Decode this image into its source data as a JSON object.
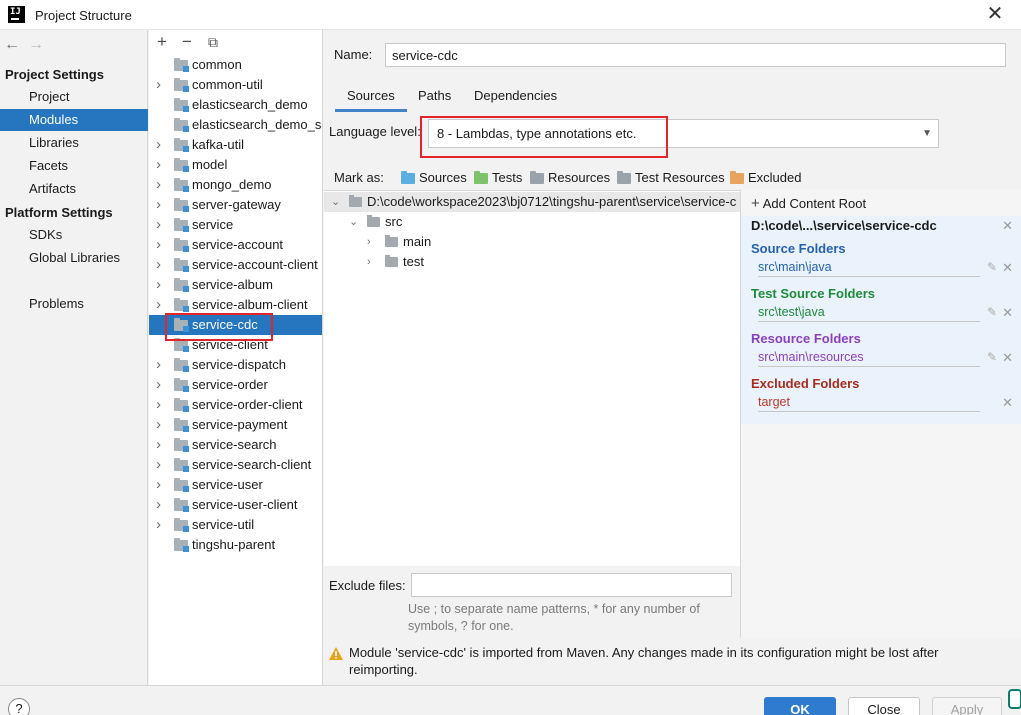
{
  "window": {
    "title": "Project Structure",
    "app_icon_text": "IJ"
  },
  "nav": {
    "back_glyph": "←",
    "forward_glyph": "→",
    "sections": [
      {
        "title": "Project Settings",
        "items": [
          "Project",
          "Modules",
          "Libraries",
          "Facets",
          "Artifacts"
        ]
      },
      {
        "title": "Platform Settings",
        "items": [
          "SDKs",
          "Global Libraries"
        ]
      }
    ],
    "problems": "Problems",
    "selected": "Modules"
  },
  "modules": {
    "toolbar": {
      "add": "+",
      "remove": "−",
      "copy": "⧉"
    },
    "items": [
      {
        "label": "common",
        "expandable": false
      },
      {
        "label": "common-util",
        "expandable": true
      },
      {
        "label": "elasticsearch_demo",
        "expandable": false
      },
      {
        "label": "elasticsearch_demo_sp",
        "expandable": false
      },
      {
        "label": "kafka-util",
        "expandable": true
      },
      {
        "label": "model",
        "expandable": true
      },
      {
        "label": "mongo_demo",
        "expandable": true
      },
      {
        "label": "server-gateway",
        "expandable": true
      },
      {
        "label": "service",
        "expandable": true
      },
      {
        "label": "service-account",
        "expandable": true
      },
      {
        "label": "service-account-client",
        "expandable": true
      },
      {
        "label": "service-album",
        "expandable": true
      },
      {
        "label": "service-album-client",
        "expandable": true
      },
      {
        "label": "service-cdc",
        "expandable": false
      },
      {
        "label": "service-client",
        "expandable": false
      },
      {
        "label": "service-dispatch",
        "expandable": true
      },
      {
        "label": "service-order",
        "expandable": true
      },
      {
        "label": "service-order-client",
        "expandable": true
      },
      {
        "label": "service-payment",
        "expandable": true
      },
      {
        "label": "service-search",
        "expandable": true
      },
      {
        "label": "service-search-client",
        "expandable": true
      },
      {
        "label": "service-user",
        "expandable": true
      },
      {
        "label": "service-user-client",
        "expandable": true
      },
      {
        "label": "service-util",
        "expandable": true
      },
      {
        "label": "tingshu-parent",
        "expandable": false
      }
    ],
    "selected": "service-cdc"
  },
  "details": {
    "name_label": "Name:",
    "name_value": "service-cdc",
    "tabs": [
      "Sources",
      "Paths",
      "Dependencies"
    ],
    "active_tab": "Sources",
    "language_level_label": "Language level:",
    "language_level_value": "8 - Lambdas, type annotations etc.",
    "mark_as_label": "Mark as:",
    "mark_as": [
      {
        "label": "Sources",
        "color": "#5aaee0"
      },
      {
        "label": "Tests",
        "color": "#7ec26c"
      },
      {
        "label": "Resources",
        "color": "#9aa3ac"
      },
      {
        "label": "Test Resources",
        "color": "#9aa3ac"
      },
      {
        "label": "Excluded",
        "color": "#e8a35c"
      }
    ],
    "tree": {
      "root": "D:\\code\\workspace2023\\bj0712\\tingshu-parent\\service\\service-c",
      "children": [
        {
          "label": "src",
          "depth": 1,
          "expanded": true
        },
        {
          "label": "main",
          "depth": 2,
          "expanded": false
        },
        {
          "label": "test",
          "depth": 2,
          "expanded": false
        }
      ]
    },
    "exclude_files_label": "Exclude files:",
    "exclude_files_value": "",
    "exclude_hint": "Use ; to separate name patterns, * for any number of symbols, ? for one.",
    "content_root": {
      "add_label": "Add Content Root",
      "path": "D:\\code\\...\\service\\service-cdc",
      "groups": [
        {
          "title": "Source Folders",
          "folder": "src\\main\\java",
          "title_color": "#2661b0",
          "folder_color": "#2661b0"
        },
        {
          "title": "Test Source Folders",
          "folder": "src\\test\\java",
          "title_color": "#1f8a3a",
          "folder_color": "#1f8a3a"
        },
        {
          "title": "Resource Folders",
          "folder": "src\\main\\resources",
          "title_color": "#8a3fc0",
          "folder_color": "#8a3fc0"
        },
        {
          "title": "Excluded Folders",
          "folder": "target",
          "title_color": "#a82c1c",
          "folder_color": "#c0392b"
        }
      ]
    },
    "warning": "Module 'service-cdc' is imported from Maven. Any changes made in its configuration might be lost after reimporting."
  },
  "buttons": {
    "help": "?",
    "ok": "OK",
    "close": "Close",
    "apply": "Apply"
  },
  "colors": {
    "selection": "#2675bf",
    "highlight_box": "#e0262b",
    "ok_button": "#2e7bd0"
  }
}
